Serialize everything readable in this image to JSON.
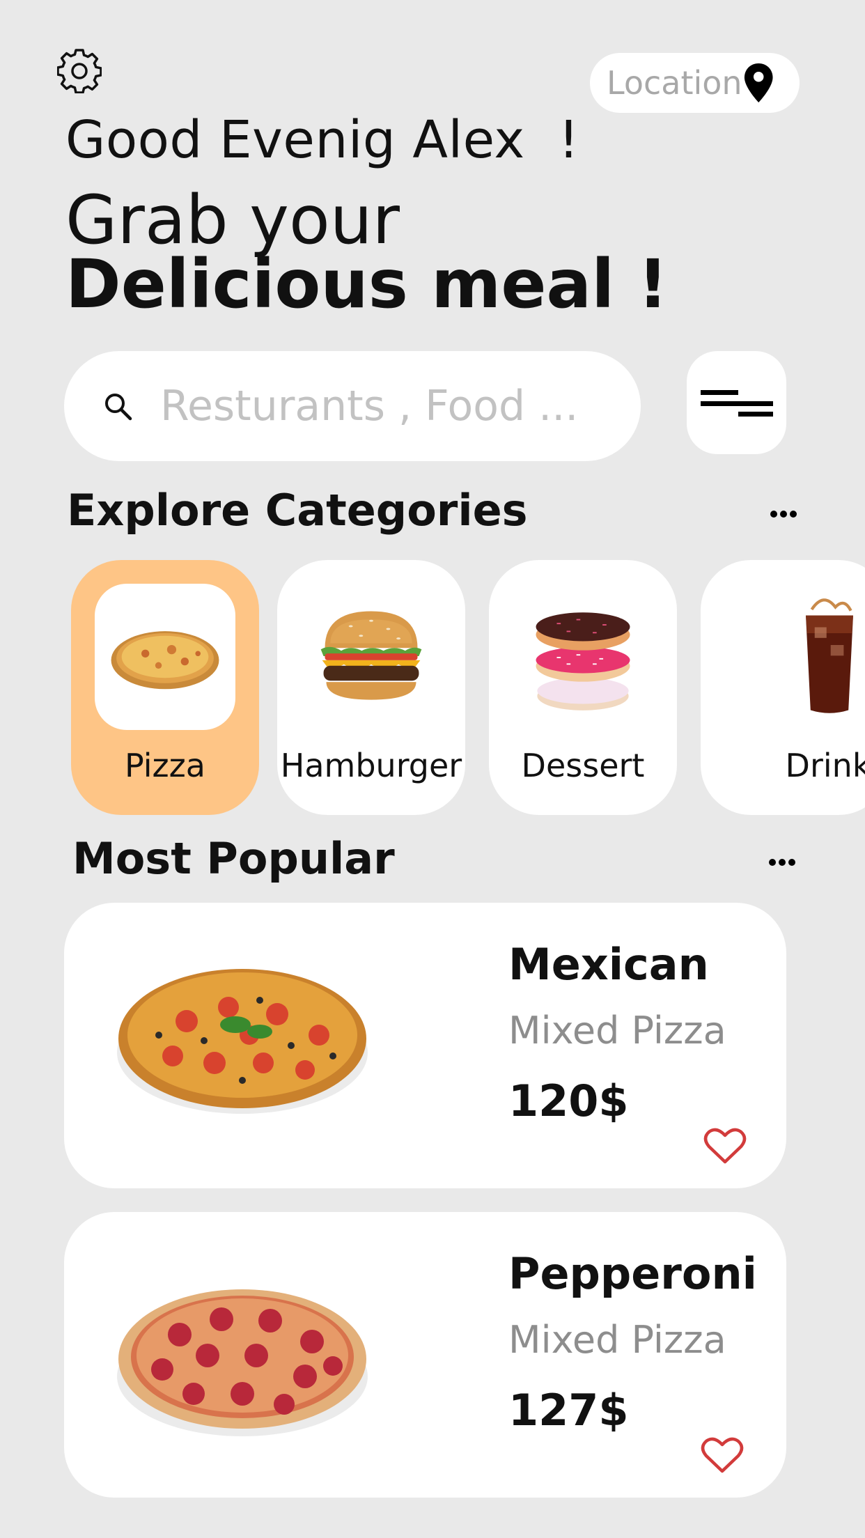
{
  "header": {
    "settings_icon": "gear-icon",
    "location": {
      "label": "Location",
      "icon": "location-pin-icon"
    }
  },
  "greeting": {
    "line": "Good Evenig Alex  !",
    "headline_regular": "Grab your",
    "headline_bold": "Delicious meal !"
  },
  "search": {
    "placeholder": "Resturants , Food ...",
    "value": "",
    "icon": "search-icon",
    "filter_icon": "filter-icon"
  },
  "categories": {
    "title": "Explore Categories",
    "more_icon": "more-icon",
    "items": [
      {
        "label": "Pizza",
        "icon": "pizza-image",
        "selected": true
      },
      {
        "label": "Hamburger",
        "icon": "hamburger-image",
        "selected": false
      },
      {
        "label": "Dessert",
        "icon": "donuts-image",
        "selected": false
      },
      {
        "label": "Drink",
        "icon": "cola-image",
        "selected": false
      }
    ]
  },
  "popular": {
    "title": "Most Popular",
    "more_icon": "more-icon",
    "items": [
      {
        "name": "Mexican",
        "type": "Mixed Pizza",
        "price": "120$",
        "favorite_icon": "heart-icon"
      },
      {
        "name": "Pepperoni",
        "type": "Mixed Pizza",
        "price": "127$",
        "favorite_icon": "heart-icon"
      }
    ]
  },
  "colors": {
    "background": "#e9e9e9",
    "card": "#ffffff",
    "accent": "#fec586",
    "heart": "#d23b3b",
    "muted_text": "#8d8d8d"
  }
}
